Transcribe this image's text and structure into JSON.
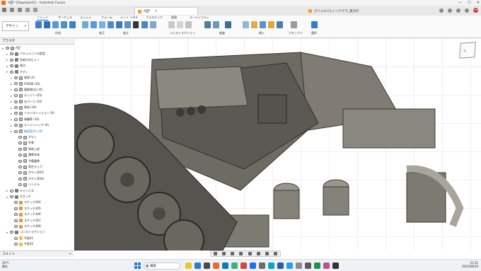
{
  "titlebar": {
    "title": "A型* ([Applejack]) - Autodesk Fusion",
    "controls": [
      "—",
      "☐",
      "✕"
    ]
  },
  "tabs": [
    {
      "label": "A型*",
      "active": true
    },
    {
      "label": "グリル4パルインテグラ_無点灯",
      "active": false
    }
  ],
  "user_initials": "HH",
  "workspace": {
    "label": "デザイン"
  },
  "ribbon_tabs": [
    "ソリッド",
    "サーフェス",
    "メッシュ",
    "フォーム",
    "シート メタル",
    "プラスチック",
    "管理",
    "ユーティリティ"
  ],
  "ribbon_groups": [
    "作成",
    "修正",
    "組立",
    "コンストラクション",
    "検査",
    "挿入",
    "アセンブリ",
    "選択"
  ],
  "browser": {
    "header": "ブラウザ",
    "root": "A型",
    "items": [
      "ドキュメントの設定",
      "名前付きビュー",
      "原点",
      "ボディ",
      "車体 (2)",
      "FUKSB (10)",
      "操縦席(左) (6)",
      "エンジン (25)",
      "左パーツ (10)",
      "車体 (16)",
      "トランスミッション (6)",
      "車輪等 (10)",
      "エンジンハッチ (6)",
      "砲塔室(片) (9)",
      "ボディ",
      "外装",
      "車体上部",
      "履帯本体",
      "予備履帯",
      "荷台ラック",
      "ボディ3023",
      "ボディ3024",
      "ハンドル",
      "キャンバス",
      "スケッチ",
      "スケッチ304",
      "スケッチ305",
      "スケッチ306",
      "スケッチ307",
      "スケッチ308",
      "コンストラクション",
      "平面31",
      "平面32"
    ]
  },
  "comments": {
    "label": "コメント",
    "add": "+"
  },
  "viewcube_label": "右",
  "taskbar": {
    "weather_temp": "20°C",
    "weather_text": "晴れ",
    "search_placeholder": "検索",
    "time": "21:31",
    "date": "2025/09/29"
  }
}
